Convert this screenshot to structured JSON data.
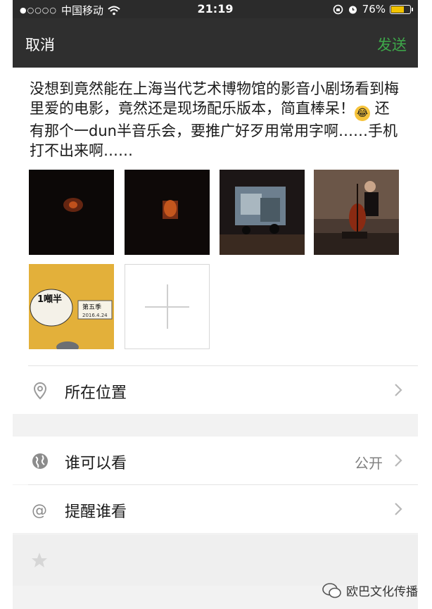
{
  "status_bar": {
    "signal": "●○○○○",
    "carrier": "中国移动",
    "time": "21:19",
    "battery": "76%",
    "battery_level": 0.76
  },
  "nav": {
    "cancel_label": "取消",
    "send_label": "发送"
  },
  "post": {
    "text_before_emoji": "没想到竟然能在上海当代艺术博物馆的影音小剧场看到梅里爱的电影，竟然还是现场配乐版本，简直棒呆！",
    "text_after_emoji": " 还有那个一dun半音乐会，要推广好歹用常用字啊……手机打不出来啊……",
    "photo_5_text_1": "1噸半",
    "photo_5_text_2": "第五季",
    "photo_5_text_3": "2016.4.24"
  },
  "options": {
    "location_label": "所在位置",
    "visibility_label": "谁可以看",
    "visibility_value": "公开",
    "mention_label": "提醒谁看"
  },
  "watermark": {
    "text": "欧巴文化传播"
  },
  "colors": {
    "send_green": "#3ea84a",
    "nav_bg": "#2f2f2f"
  }
}
